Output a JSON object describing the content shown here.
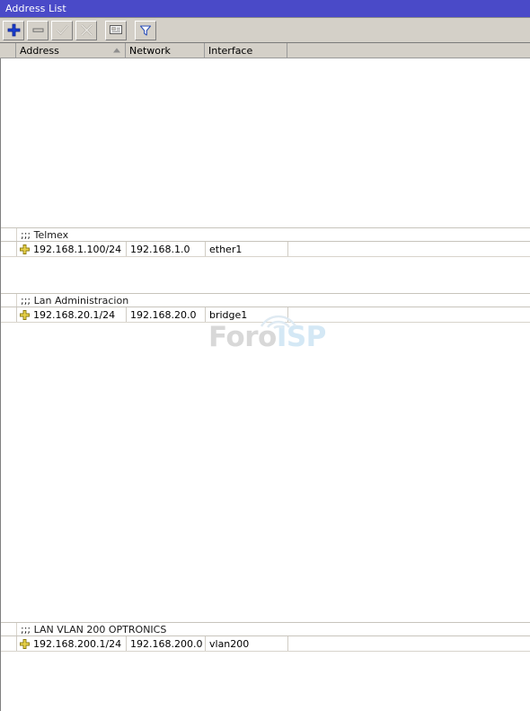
{
  "window": {
    "title": "Address List"
  },
  "toolbar": {
    "buttons": [
      {
        "name": "add-button",
        "icon": "plus-icon",
        "label": "Add",
        "enabled": true
      },
      {
        "name": "remove-button",
        "icon": "minus-icon",
        "label": "Remove",
        "enabled": true
      },
      {
        "name": "enable-button",
        "icon": "check-icon",
        "label": "Enable",
        "enabled": false
      },
      {
        "name": "disable-button",
        "icon": "cross-icon",
        "label": "Disable",
        "enabled": false
      },
      {
        "name": "comment-button",
        "icon": "comment-icon",
        "label": "Comment",
        "enabled": true
      },
      {
        "name": "filter-button",
        "icon": "filter-icon",
        "label": "Filter",
        "enabled": true
      }
    ]
  },
  "table": {
    "columns": [
      {
        "key": "gutter",
        "label": ""
      },
      {
        "key": "address",
        "label": "Address",
        "sort": "ascending"
      },
      {
        "key": "network",
        "label": "Network"
      },
      {
        "key": "interface",
        "label": "Interface"
      },
      {
        "key": "rest",
        "label": ""
      }
    ],
    "groups": [
      {
        "comment": ";;; Telmex",
        "rows": [
          {
            "flag": "static-address-icon",
            "address": "192.168.1.100/24",
            "network": "192.168.1.0",
            "interface": "ether1"
          }
        ]
      },
      {
        "comment": ";;; Lan Administracion",
        "rows": [
          {
            "flag": "static-address-icon",
            "address": "192.168.20.1/24",
            "network": "192.168.20.0",
            "interface": "bridge1"
          }
        ]
      },
      {
        "comment": ";;; LAN VLAN 200 OPTRONICS",
        "rows": [
          {
            "flag": "static-address-icon",
            "address": "192.168.200.1/24",
            "network": "192.168.200.0",
            "interface": "vlan200"
          }
        ]
      }
    ]
  },
  "watermark": {
    "text_primary": "Foro",
    "text_accent": "ISP",
    "color_primary": "#d8d8d8",
    "color_accent": "#d4e8f5"
  },
  "colors": {
    "titlebar_background": "#4a4ac8",
    "titlebar_text": "#ffffff",
    "toolbar_background": "#d4d0c8",
    "header_background": "#d4d0c8",
    "list_background": "#ffffff",
    "accent_plus": "#1a3fd0",
    "flag_yellow": "#e8d24a"
  }
}
